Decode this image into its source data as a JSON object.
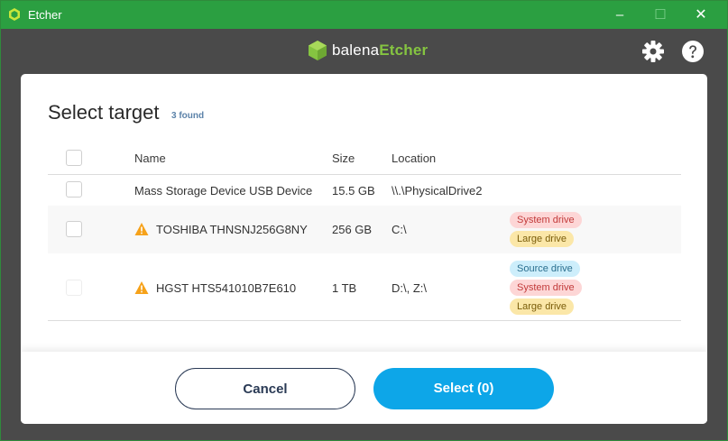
{
  "window": {
    "title": "Etcher",
    "minimize": "–",
    "maximize": "☐",
    "close": "✕"
  },
  "header": {
    "brand_part1": "balena",
    "brand_part2": "Etcher",
    "brand_color": "#85c441"
  },
  "modal": {
    "title": "Select target",
    "found": "3 found",
    "columns": {
      "name": "Name",
      "size": "Size",
      "location": "Location"
    },
    "rows": [
      {
        "name": "Mass Storage Device USB Device",
        "size": "15.5 GB",
        "location": "\\\\.\\PhysicalDrive2",
        "warning": false,
        "badges": []
      },
      {
        "name": "TOSHIBA THNSNJ256G8NY",
        "size": "256 GB",
        "location": "C:\\",
        "warning": true,
        "badges": [
          "System drive",
          "Large drive"
        ]
      },
      {
        "name": "HGST HTS541010B7E610",
        "size": "1 TB",
        "location": "D:\\, Z:\\",
        "warning": true,
        "badges": [
          "Source drive",
          "System drive",
          "Large drive"
        ]
      }
    ],
    "cancel_label": "Cancel",
    "select_label": "Select (0)"
  },
  "icons": [
    "etcher-logo-icon",
    "gear-icon",
    "help-icon",
    "warning-icon"
  ]
}
